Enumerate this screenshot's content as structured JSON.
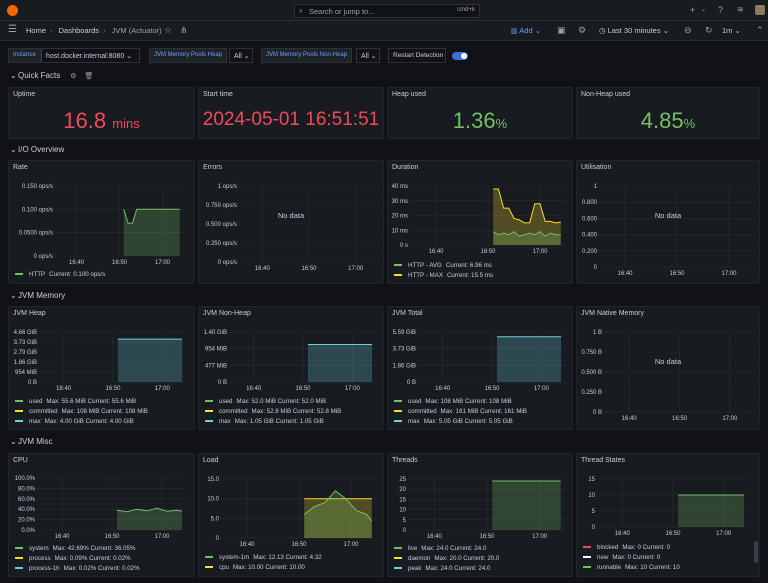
{
  "topbar": {
    "search_placeholder": "Search or jump to...",
    "search_shortcut": "cmd+k",
    "plus_label": "+"
  },
  "breadcrumb": {
    "home": "Home",
    "dashboards": "Dashboards",
    "current": "JVM (Actuator)"
  },
  "toolbar": {
    "add_label": "Add",
    "time_range": "Last 30 minutes",
    "refresh_interval": "1m"
  },
  "variables": [
    {
      "label": "Instance",
      "value": "host.docker.internal:8080"
    },
    {
      "label": "JVM Memory Pools Heap",
      "value": "All"
    },
    {
      "label": "JVM Memory Pools Non-Heap",
      "value": "All"
    }
  ],
  "restart_detection": {
    "label": "Restart Detection",
    "enabled": true
  },
  "rows": {
    "quick_facts": "Quick Facts",
    "io_overview": "I/O Overview",
    "jvm_memory": "JVM Memory",
    "jvm_misc": "JVM Misc"
  },
  "stats": {
    "uptime": {
      "title": "Uptime",
      "value": "16.8",
      "unit": "mins",
      "color": "#f2495c"
    },
    "start_time": {
      "title": "Start time",
      "value": "2024-05-01 16:51:51",
      "color": "#f2495c"
    },
    "heap_used": {
      "title": "Heap used",
      "value": "1.36",
      "unit": "%",
      "color": "#73bf69"
    },
    "nonheap_used": {
      "title": "Non-Heap used",
      "value": "4.85",
      "unit": "%",
      "color": "#73bf69"
    }
  },
  "no_data": "No data",
  "panels": {
    "rate": {
      "title": "Rate"
    },
    "errors": {
      "title": "Errors"
    },
    "duration": {
      "title": "Duration"
    },
    "utilisation": {
      "title": "Utilisation"
    },
    "jvm_heap": {
      "title": "JVM Heap"
    },
    "jvm_nonheap": {
      "title": "JVM Non-Heap"
    },
    "jvm_total": {
      "title": "JVM Total"
    },
    "jvm_native": {
      "title": "JVM Native Memory"
    },
    "cpu": {
      "title": "CPU"
    },
    "load": {
      "title": "Load"
    },
    "threads": {
      "title": "Threads"
    },
    "thread_states": {
      "title": "Thread States"
    }
  },
  "legends": {
    "rate": [
      {
        "name": "HTTP",
        "stats": "Current: 0.100 ops/s",
        "color": "#73bf69"
      }
    ],
    "duration": [
      {
        "name": "HTTP - AVG",
        "stats": "Current: 6.96 ms",
        "color": "#73bf69"
      },
      {
        "name": "HTTP - MAX",
        "stats": "Current: 15.5 ms",
        "color": "#fade2a"
      }
    ],
    "jvm_heap": [
      {
        "name": "used",
        "stats": "Max: 55.6 MiB  Current: 55.6 MiB",
        "color": "#73bf69"
      },
      {
        "name": "committed",
        "stats": "Max: 108 MiB  Current: 108 MiB",
        "color": "#fade2a"
      },
      {
        "name": "max",
        "stats": "Max: 4.00 GiB  Current: 4.00 GiB",
        "color": "#6ed0e0"
      }
    ],
    "jvm_nonheap": [
      {
        "name": "used",
        "stats": "Max: 52.0 MiB  Current: 52.0 MiB",
        "color": "#73bf69"
      },
      {
        "name": "committed",
        "stats": "Max: 52.8 MiB  Current: 52.8 MiB",
        "color": "#fade2a"
      },
      {
        "name": "max",
        "stats": "Max: 1.05 GiB  Current: 1.05 GiB",
        "color": "#6ed0e0"
      }
    ],
    "jvm_total": [
      {
        "name": "used",
        "stats": "Max: 108 MiB  Current: 108 MiB",
        "color": "#73bf69"
      },
      {
        "name": "committed",
        "stats": "Max: 161 MiB  Current: 161 MiB",
        "color": "#fade2a"
      },
      {
        "name": "max",
        "stats": "Max: 5.05 GiB  Current: 5.05 GiB",
        "color": "#6ed0e0"
      }
    ],
    "cpu": [
      {
        "name": "system",
        "stats": "Max: 42.69%  Current: 36.05%",
        "color": "#73bf69"
      },
      {
        "name": "process",
        "stats": "Max: 0.09%  Current: 0.02%",
        "color": "#fade2a"
      },
      {
        "name": "process-1h",
        "stats": "Max: 0.02%  Current: 0.02%",
        "color": "#6ed0e0"
      }
    ],
    "load": [
      {
        "name": "system-1m",
        "stats": "Max: 12.13  Current: 4.32",
        "color": "#73bf69"
      },
      {
        "name": "cpu",
        "stats": "Max: 10.00  Current: 10.00",
        "color": "#fade2a"
      }
    ],
    "threads": [
      {
        "name": "live",
        "stats": "Max: 24.0  Current: 24.0",
        "color": "#73bf69"
      },
      {
        "name": "daemon",
        "stats": "Max: 20.0  Current: 20.0",
        "color": "#fade2a"
      },
      {
        "name": "peak",
        "stats": "Max: 24.0  Current: 24.0",
        "color": "#6ed0e0"
      }
    ],
    "thread_states": [
      {
        "name": "blocked",
        "stats": "Max: 0  Current: 0",
        "color": "#f2495c"
      },
      {
        "name": "new",
        "stats": "Max: 0  Current: 0",
        "color": "#ffffff"
      },
      {
        "name": "runnable",
        "stats": "Max: 10  Current: 10",
        "color": "#73bf69"
      }
    ]
  },
  "chart_data": [
    {
      "id": "rate",
      "type": "line",
      "yticks": [
        "0.150 ops/s",
        "0.100 ops/s",
        "0.0500 ops/s",
        "0 ops/s"
      ],
      "xticks": [
        "16:40",
        "16:50",
        "17:00"
      ],
      "ylim": [
        0,
        0.15
      ],
      "series": [
        {
          "name": "HTTP",
          "x": [
            "16:51",
            "16:52",
            "16:53",
            "16:54",
            "17:04"
          ],
          "values": [
            0.1,
            0.07,
            0.07,
            0.1,
            0.1
          ]
        }
      ]
    },
    {
      "id": "errors",
      "type": "line",
      "yticks": [
        "1 ops/s",
        "0.750 ops/s",
        "0.500 ops/s",
        "0.250 ops/s",
        "0 ops/s"
      ],
      "xticks": [
        "16:40",
        "16:50",
        "17:00"
      ],
      "ylim": [
        0,
        1
      ],
      "series": []
    },
    {
      "id": "duration",
      "type": "line",
      "yticks": [
        "40 ms",
        "30 ms",
        "20 ms",
        "10 ms",
        "0 s"
      ],
      "xticks": [
        "16:40",
        "16:50",
        "17:00"
      ],
      "ylim": [
        0,
        40
      ],
      "series": [
        {
          "name": "HTTP - MAX",
          "x": [
            "16:51",
            "16:52",
            "16:53",
            "16:54",
            "16:55",
            "16:56",
            "16:57",
            "16:58",
            "16:59",
            "17:00",
            "17:01",
            "17:02",
            "17:03",
            "17:04"
          ],
          "values": [
            38,
            38,
            25,
            25,
            18,
            17,
            15,
            15,
            28,
            28,
            16,
            16,
            15,
            15.5
          ]
        },
        {
          "name": "HTTP - AVG",
          "x": [
            "16:51",
            "16:52",
            "16:53",
            "16:54",
            "16:55",
            "16:56",
            "16:57",
            "16:58",
            "16:59",
            "17:00",
            "17:01",
            "17:02",
            "17:03",
            "17:04"
          ],
          "values": [
            9,
            7,
            8,
            7,
            9,
            6,
            7,
            8,
            7,
            9,
            6,
            8,
            7,
            6.96
          ]
        }
      ]
    },
    {
      "id": "utilisation",
      "type": "line",
      "yticks": [
        "1",
        "0.800",
        "0.600",
        "0.400",
        "0.200",
        "0"
      ],
      "xticks": [
        "16:40",
        "16:50",
        "17:00"
      ],
      "ylim": [
        0,
        1
      ],
      "series": []
    },
    {
      "id": "jvm_heap",
      "type": "area",
      "yticks": [
        "4.66 GiB",
        "3.73 GiB",
        "2.79 GiB",
        "1.86 GiB",
        "954 MiB",
        "0 B"
      ],
      "xticks": [
        "16:40",
        "16:50",
        "17:00"
      ],
      "ylim": [
        0,
        4.66
      ],
      "series": [
        {
          "name": "max",
          "x": [
            "16:51",
            "17:04"
          ],
          "values": [
            4.0,
            4.0
          ]
        }
      ]
    },
    {
      "id": "jvm_nonheap",
      "type": "area",
      "yticks": [
        "1.40 GiB",
        "954 MiB",
        "477 MiB",
        "0 B"
      ],
      "xticks": [
        "16:40",
        "16:50",
        "17:00"
      ],
      "ylim": [
        0,
        1.4
      ],
      "series": [
        {
          "name": "max",
          "x": [
            "16:51",
            "17:04"
          ],
          "values": [
            1.05,
            1.05
          ]
        }
      ]
    },
    {
      "id": "jvm_total",
      "type": "area",
      "yticks": [
        "5.59 GiB",
        "3.73 GiB",
        "1.86 GiB",
        "0 B"
      ],
      "xticks": [
        "16:40",
        "16:50",
        "17:00"
      ],
      "ylim": [
        0,
        5.59
      ],
      "series": [
        {
          "name": "max",
          "x": [
            "16:51",
            "17:04"
          ],
          "values": [
            5.05,
            5.05
          ]
        }
      ]
    },
    {
      "id": "jvm_native",
      "type": "line",
      "yticks": [
        "1 B",
        "0.750 B",
        "0.500 B",
        "0.250 B",
        "0 B"
      ],
      "xticks": [
        "16:40",
        "16:50",
        "17:00"
      ],
      "ylim": [
        0,
        1
      ],
      "series": []
    },
    {
      "id": "cpu",
      "type": "area",
      "yticks": [
        "100.0%",
        "80.0%",
        "60.0%",
        "40.0%",
        "20.0%",
        "0.0%"
      ],
      "xticks": [
        "16:40",
        "16:50",
        "17:00"
      ],
      "ylim": [
        0,
        100
      ],
      "series": [
        {
          "name": "system",
          "x": [
            "16:51",
            "16:53",
            "16:55",
            "16:57",
            "16:59",
            "17:01",
            "17:03",
            "17:04"
          ],
          "values": [
            38,
            35,
            40,
            37,
            42,
            36,
            38,
            36
          ]
        }
      ]
    },
    {
      "id": "load",
      "type": "area",
      "yticks": [
        "15.0",
        "10.0",
        "5.0",
        "0"
      ],
      "xticks": [
        "16:40",
        "16:50",
        "17:00"
      ],
      "ylim": [
        0,
        15
      ],
      "series": [
        {
          "name": "cpu",
          "x": [
            "16:51",
            "17:04"
          ],
          "values": [
            10,
            10
          ]
        },
        {
          "name": "system-1m",
          "x": [
            "16:51",
            "16:53",
            "16:55",
            "16:57",
            "16:59",
            "17:01",
            "17:03",
            "17:04"
          ],
          "values": [
            6,
            8,
            9,
            12,
            10,
            7,
            6,
            4.3
          ]
        }
      ]
    },
    {
      "id": "threads",
      "type": "area",
      "yticks": [
        "25",
        "20",
        "15",
        "10",
        "5",
        "0"
      ],
      "xticks": [
        "16:40",
        "16:50",
        "17:00"
      ],
      "ylim": [
        0,
        25
      ],
      "series": [
        {
          "name": "live",
          "x": [
            "16:51",
            "17:04"
          ],
          "values": [
            24,
            24
          ]
        }
      ]
    },
    {
      "id": "thread_states",
      "type": "area",
      "yticks": [
        "15",
        "10",
        "5",
        "0"
      ],
      "xticks": [
        "16:40",
        "16:50",
        "17:00"
      ],
      "ylim": [
        0,
        15
      ],
      "series": [
        {
          "name": "runnable",
          "x": [
            "16:51",
            "17:04"
          ],
          "values": [
            10,
            10
          ]
        }
      ]
    }
  ]
}
